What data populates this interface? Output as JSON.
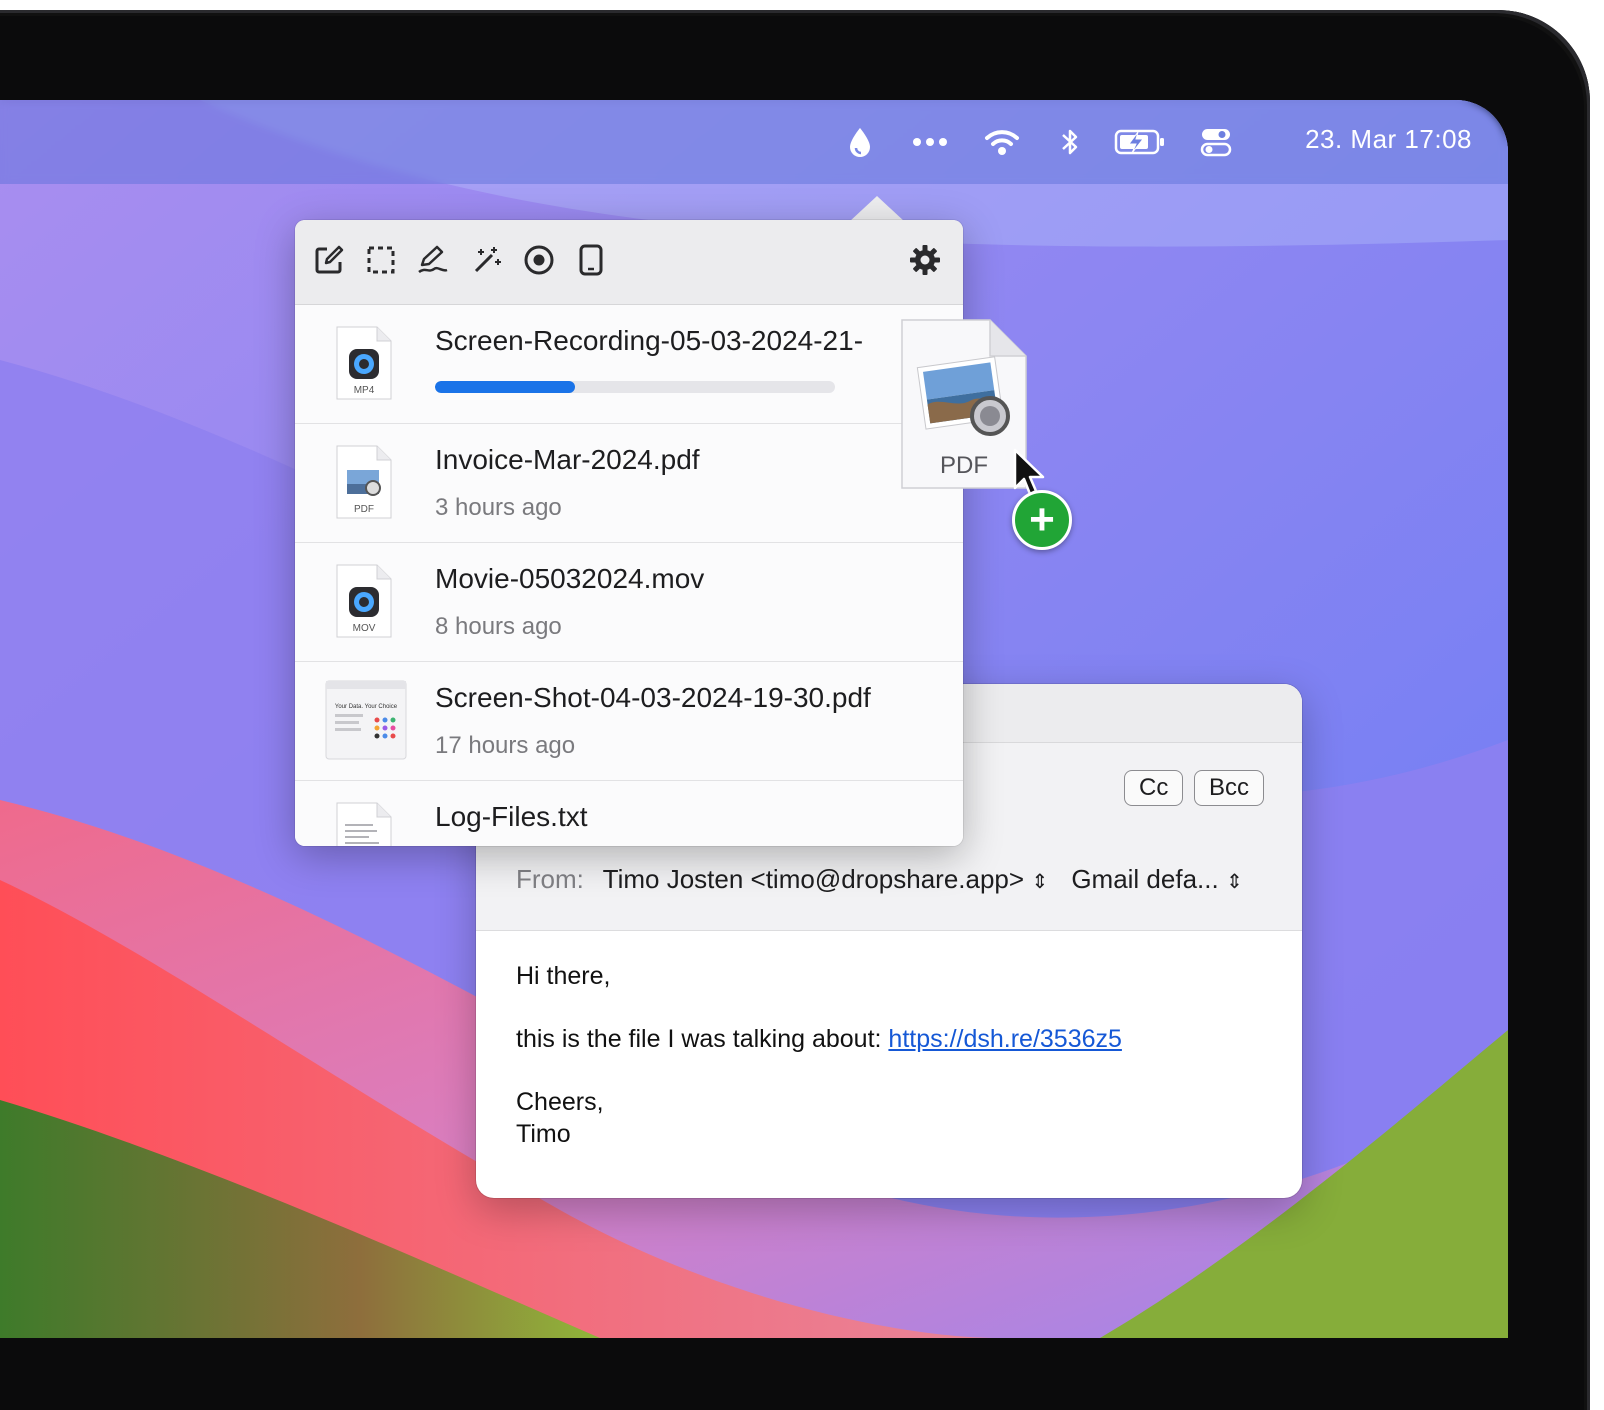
{
  "menubar": {
    "icons": [
      "dropshare-drop-icon",
      "more-dots-icon",
      "wifi-icon",
      "bluetooth-icon",
      "battery-charging-icon",
      "control-center-icon"
    ],
    "clock": "23. Mar  17:08"
  },
  "popover": {
    "tools": [
      "annotate-icon",
      "screenshot-area-icon",
      "draw-icon",
      "magic-wand-icon",
      "record-icon",
      "device-icon",
      "settings-gear-icon"
    ],
    "items": [
      {
        "name": "Screen-Recording-05-03-2024-21-",
        "badge": "MP4",
        "progress": 0.35
      },
      {
        "name": "Invoice-Mar-2024.pdf",
        "time": "3 hours ago",
        "badge": "PDF"
      },
      {
        "name": "Movie-05032024.mov",
        "time": "8 hours ago",
        "badge": "MOV"
      },
      {
        "name": "Screen-Shot-04-03-2024-19-30.pdf",
        "time": "17 hours ago",
        "thumb_text": "Your Data. Your Choice"
      },
      {
        "name": "Log-Files.txt"
      }
    ]
  },
  "drag": {
    "label": "PDF"
  },
  "mail": {
    "cc": "Cc",
    "bcc": "Bcc",
    "from_label": "From:",
    "from_value": "Timo Josten <timo@dropshare.app>",
    "account": "Gmail defa...",
    "greeting": "Hi there,",
    "line_prefix": "this is the file I was talking about: ",
    "link": "https://dsh.re/3536z5",
    "signoff": "Cheers,",
    "signature": "Timo"
  },
  "colors": {
    "accent": "#1a73e8",
    "link": "#1558d6",
    "plus": "#21a536"
  }
}
